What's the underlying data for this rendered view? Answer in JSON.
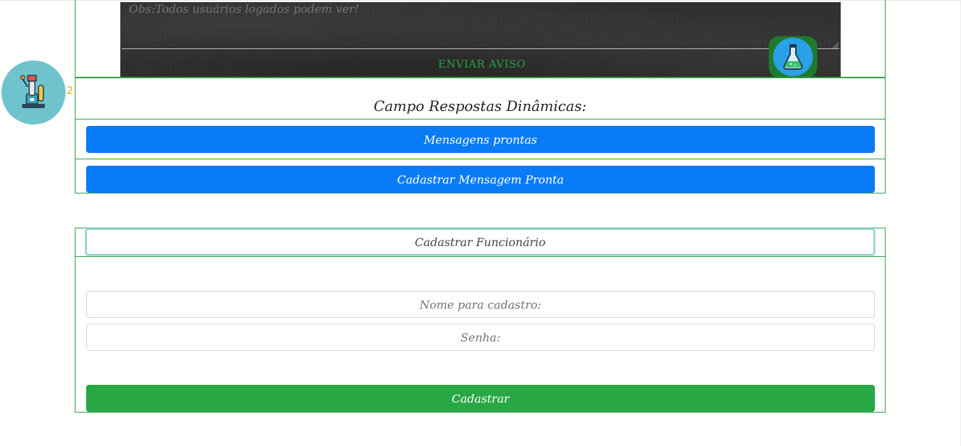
{
  "notice": {
    "placeholder": "Obs:Todos usuários logados podem ver!",
    "send_label": "ENVIAR AVISO"
  },
  "icons": {
    "avatar": "lab-equipment-icon",
    "flask": "flask-icon"
  },
  "avatar_badge": "2",
  "dynamic_answers": {
    "title": "Campo Respostas Dinâmicas:",
    "ready_messages_label": "Mensagens prontas",
    "register_message_label": "Cadastrar Mensagem Pronta"
  },
  "register_employee": {
    "toggle_label": "Cadastrar Funcionário",
    "name_placeholder": "Nome para cadastro:",
    "password_placeholder": "Senha:",
    "submit_label": "Cadastrar"
  },
  "colors": {
    "section_border": "#2e9e45",
    "primary_blue": "#0a7bf6",
    "success_green": "#28a745",
    "avatar_bg": "#6fc3cc",
    "chalkboard": "#2f2f2f"
  }
}
